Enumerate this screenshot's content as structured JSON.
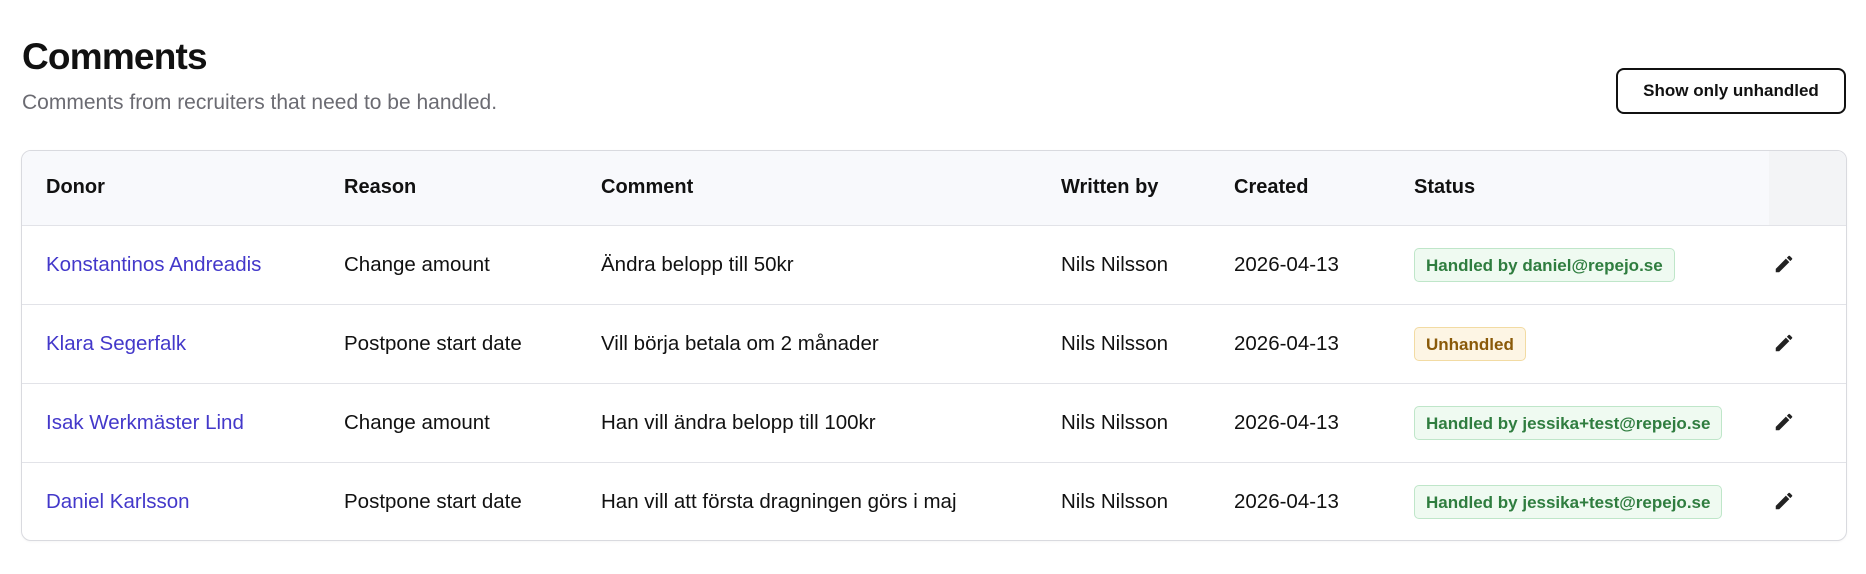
{
  "page": {
    "title": "Comments",
    "subtitle": "Comments from recruiters that need to be handled.",
    "filter_button_label": "Show only unhandled"
  },
  "table": {
    "headers": {
      "donor": "Donor",
      "reason": "Reason",
      "comment": "Comment",
      "written_by": "Written by",
      "created": "Created",
      "status": "Status"
    },
    "rows": [
      {
        "donor": "Konstantinos Andreadis",
        "reason": "Change amount",
        "comment": "Ändra belopp till 50kr",
        "written_by": "Nils Nilsson",
        "created": "2026-04-13",
        "status": "Handled by daniel@repejo.se",
        "status_type": "handled"
      },
      {
        "donor": "Klara Segerfalk",
        "reason": "Postpone start date",
        "comment": "Vill börja betala om 2 månader",
        "written_by": "Nils Nilsson",
        "created": "2026-04-13",
        "status": "Unhandled",
        "status_type": "unhandled"
      },
      {
        "donor": "Isak Werkmäster Lind",
        "reason": "Change amount",
        "comment": "Han vill ändra belopp till 100kr",
        "written_by": "Nils Nilsson",
        "created": "2026-04-13",
        "status": "Handled by jessika+test@repejo.se",
        "status_type": "handled"
      },
      {
        "donor": "Daniel Karlsson",
        "reason": "Postpone start date",
        "comment": "Han vill att första dragningen görs i maj",
        "written_by": "Nils Nilsson",
        "created": "2026-04-13",
        "status": "Handled by jessika+test@repejo.se",
        "status_type": "handled"
      }
    ]
  },
  "icons": {
    "row_action": "pencil-icon"
  },
  "colors": {
    "link": "#4338ca",
    "handled_text": "#2f7d3f",
    "handled_bg": "#effaf1",
    "unhandled_text": "#8a5a09",
    "unhandled_bg": "#fdf5e4"
  }
}
